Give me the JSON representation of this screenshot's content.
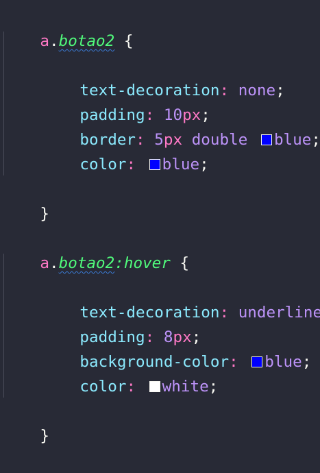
{
  "rule1": {
    "tag": "a",
    "dot": ".",
    "class_name": "botao2",
    "open_brace": "{",
    "close_brace": "}",
    "declarations": [
      {
        "property": "text-decoration",
        "value": "none"
      },
      {
        "property": "padding",
        "number": "10",
        "unit": "px"
      },
      {
        "property": "border",
        "number": "5",
        "unit": "px",
        "style": "double",
        "color_name": "blue",
        "swatch": "#0000ff"
      },
      {
        "property": "color",
        "color_name": "blue",
        "swatch": "#0000ff"
      }
    ]
  },
  "rule2": {
    "tag": "a",
    "dot": ".",
    "class_name": "botao2",
    "pseudo": ":hover",
    "open_brace": "{",
    "close_brace": "}",
    "declarations": [
      {
        "property": "text-decoration",
        "value": "underline"
      },
      {
        "property": "padding",
        "number": "8",
        "unit": "px"
      },
      {
        "property": "background-color",
        "color_name": "blue",
        "swatch": "#0000ff"
      },
      {
        "property": "color",
        "color_name": "white",
        "swatch": "#ffffff"
      }
    ]
  },
  "syntax": {
    "colon": ":",
    "semicolon": ";"
  }
}
